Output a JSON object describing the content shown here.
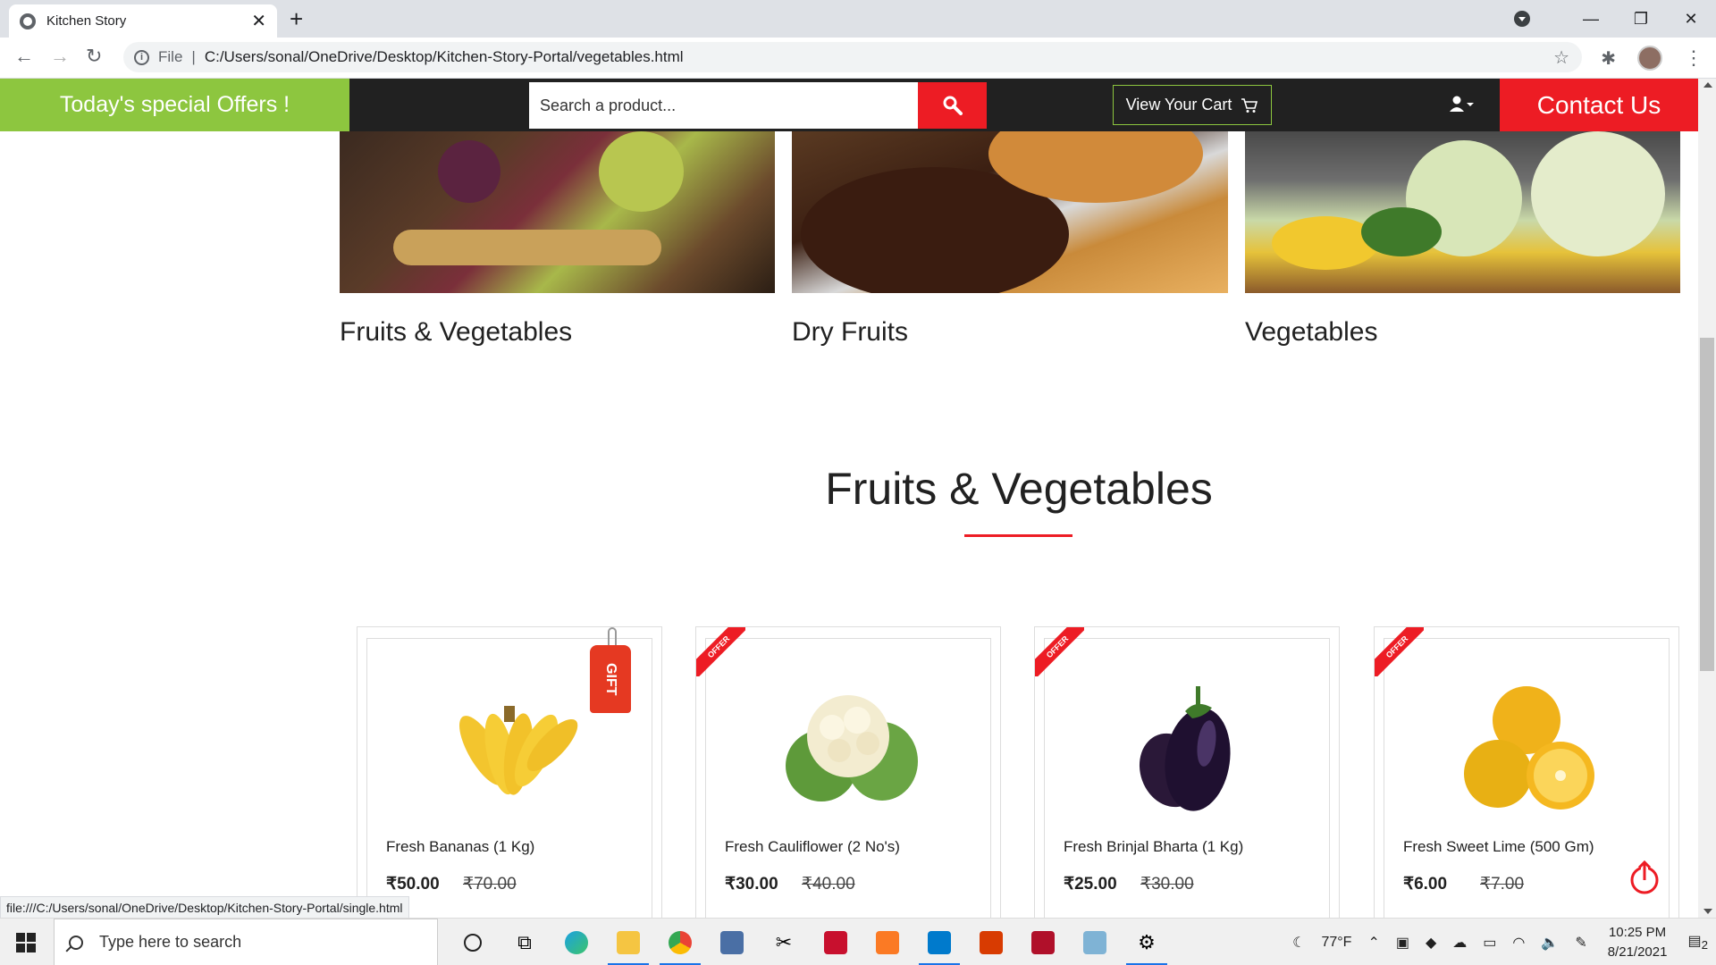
{
  "browser": {
    "tab_title": "Kitchen Story",
    "tab_close": "✕",
    "new_tab": "+",
    "url_scheme_label": "File",
    "url_separator": "|",
    "url": "C:/Users/sonal/OneDrive/Desktop/Kitchen-Story-Portal/vegetables.html",
    "status_url": "file:///C:/Users/sonal/OneDrive/Desktop/Kitchen-Story-Portal/single.html"
  },
  "header": {
    "offers_label": "Today's special Offers !",
    "search_placeholder": "Search a product...",
    "cart_label": "View Your Cart",
    "contact_label": "Contact Us",
    "colors": {
      "offers_bg": "#8dc63f",
      "accent_red": "#ed1c24",
      "header_bg": "#212121"
    }
  },
  "categories": [
    {
      "label": "Fruits & Vegetables"
    },
    {
      "label": "Dry Fruits"
    },
    {
      "label": "Vegetables"
    }
  ],
  "section": {
    "title": "Fruits & Vegetables"
  },
  "products": [
    {
      "name": "Fresh Bananas (1 Kg)",
      "price": "₹50.00",
      "old_price": "₹70.00",
      "badge": "GIFT"
    },
    {
      "name": "Fresh Cauliflower (2 No's)",
      "price": "₹30.00",
      "old_price": "₹40.00",
      "badge": "OFFER"
    },
    {
      "name": "Fresh Brinjal Bharta (1 Kg)",
      "price": "₹25.00",
      "old_price": "₹30.00",
      "badge": "OFFER"
    },
    {
      "name": "Fresh Sweet Lime (500 Gm)",
      "price": "₹6.00",
      "old_price": "₹7.00",
      "badge": "OFFER"
    }
  ],
  "taskbar": {
    "search_placeholder": "Type here to search",
    "weather": "77°F",
    "time": "10:25 PM",
    "date": "8/21/2021",
    "notifications": "2"
  }
}
